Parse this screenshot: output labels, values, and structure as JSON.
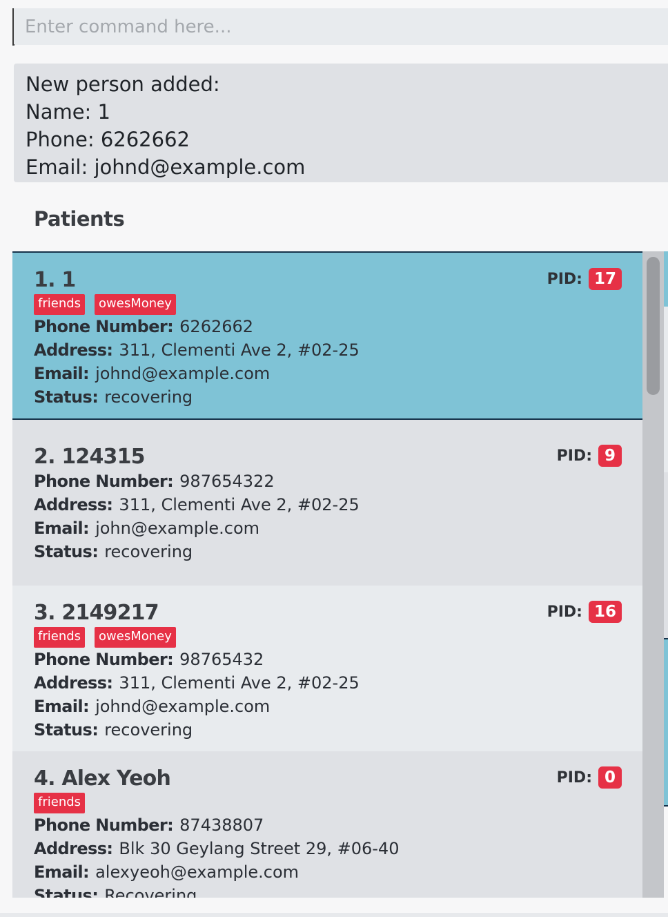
{
  "command": {
    "placeholder": "Enter command here...",
    "value": ""
  },
  "result": {
    "lines": [
      "New person added:",
      "Name: 1",
      "Phone: 6262662",
      "Email: johnd@example.com"
    ]
  },
  "panel": {
    "title": "Patients"
  },
  "labels": {
    "pid": "PID:",
    "phone": "Phone Number:",
    "address": "Address:",
    "email": "Email:",
    "status": "Status:"
  },
  "patients": [
    {
      "name": "1. 1",
      "pid": "17",
      "tags": [
        "friends",
        "owesMoney"
      ],
      "phone": "6262662",
      "address": "311, Clementi Ave 2, #02-25",
      "email": "johnd@example.com",
      "status": "recovering",
      "selected": true
    },
    {
      "name": "2. 124315",
      "pid": "9",
      "tags": [],
      "phone": "987654322",
      "address": "311, Clementi Ave 2, #02-25",
      "email": "john@example.com",
      "status": "recovering",
      "selected": false
    },
    {
      "name": "3. 2149217",
      "pid": "16",
      "tags": [
        "friends",
        "owesMoney"
      ],
      "phone": "98765432",
      "address": "311, Clementi Ave 2, #02-25",
      "email": "johnd@example.com",
      "status": "recovering",
      "selected": false
    },
    {
      "name": "4. Alex Yeoh",
      "pid": "0",
      "tags": [
        "friends"
      ],
      "phone": "87438807",
      "address": "Blk 30 Geylang Street 29, #06-40",
      "email": "alexyeoh@example.com",
      "status": "Recovering",
      "selected": false
    }
  ],
  "colors": {
    "tag": "#e63146",
    "selected_card": "#7fc3d6",
    "card_odd": "#dfe1e5",
    "card_even": "#e8ebee"
  }
}
